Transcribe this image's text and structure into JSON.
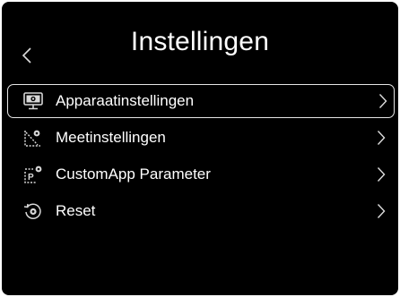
{
  "header": {
    "title": "Instellingen",
    "back_icon": "chevron-left-icon"
  },
  "menu": {
    "items": [
      {
        "label": "Apparaatinstellingen",
        "icon": "device-settings-icon",
        "selected": true
      },
      {
        "label": "Meetinstellingen",
        "icon": "measurement-settings-icon",
        "selected": false
      },
      {
        "label": "CustomApp Parameter",
        "icon": "customapp-parameter-icon",
        "selected": false
      },
      {
        "label": "Reset",
        "icon": "reset-icon",
        "selected": false
      }
    ]
  },
  "colors": {
    "background": "#000000",
    "text": "#ffffff",
    "selection_border": "#e6e6e6",
    "icon": "#d8d8d8"
  }
}
